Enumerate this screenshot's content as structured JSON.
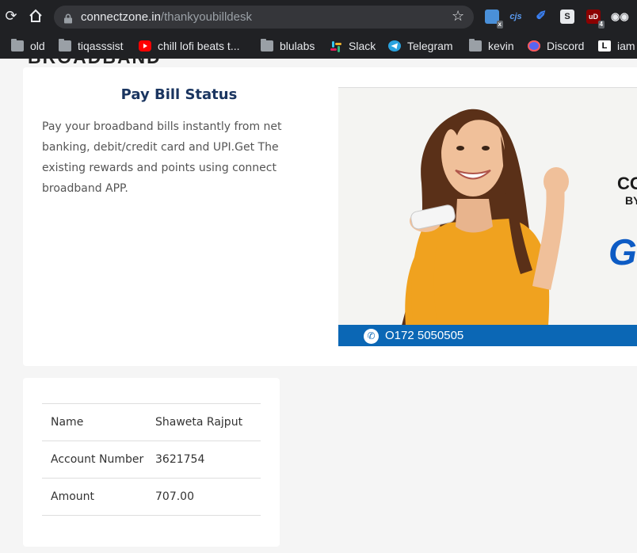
{
  "browser": {
    "url_domain": "connectzone.in",
    "url_path": "/thankyoubilldesk",
    "extensions": [
      {
        "name": "window-manager-extension",
        "label": "",
        "badge": "x",
        "color": "#4a90d9"
      },
      {
        "name": "cjs-extension",
        "label": "cjs",
        "color": "#2d6cdf"
      },
      {
        "name": "pen-extension",
        "label": "",
        "color": "#3b82f6"
      },
      {
        "name": "s-extension",
        "label": "S",
        "color": "#6b6b6b"
      },
      {
        "name": "ublock-extension",
        "label": "uD",
        "badge": "4",
        "color": "#8b0000"
      },
      {
        "name": "spy-extension",
        "label": "",
        "color": "#2a2a2a"
      }
    ]
  },
  "bookmarks": [
    {
      "label": "old",
      "icon": "folder-icon"
    },
    {
      "label": "tiqasssist",
      "icon": "folder-icon"
    },
    {
      "label": "chill lofi beats t...",
      "icon": "youtube-icon"
    },
    {
      "label": "blulabs",
      "icon": "folder-icon"
    },
    {
      "label": "Slack",
      "icon": "slack-icon"
    },
    {
      "label": "Telegram",
      "icon": "telegram-icon"
    },
    {
      "label": "kevin",
      "icon": "folder-icon"
    },
    {
      "label": "Discord",
      "icon": "discord-icon"
    },
    {
      "label": "iam",
      "icon": "l-icon"
    }
  ],
  "page": {
    "cut_heading": "BROADBAND",
    "status_title": "Pay Bill Status",
    "status_description": "Pay your broadband bills instantly from net banking, debit/credit card and UPI.Get The existing rewards and points using connect broadband APP.",
    "banner": {
      "phone": "O172 5050505",
      "brand_line1": "CO",
      "brand_line2": "BY",
      "brand_line3": "G"
    },
    "details": [
      {
        "label": "Name",
        "value": "Shaweta Rajput"
      },
      {
        "label": "Account Number",
        "value": "3621754"
      },
      {
        "label": "Amount",
        "value": "707.00"
      }
    ]
  },
  "colors": {
    "title_navy": "#1a3560",
    "banner_blue": "#0b67b5",
    "shirt_orange": "#f0a21f"
  }
}
